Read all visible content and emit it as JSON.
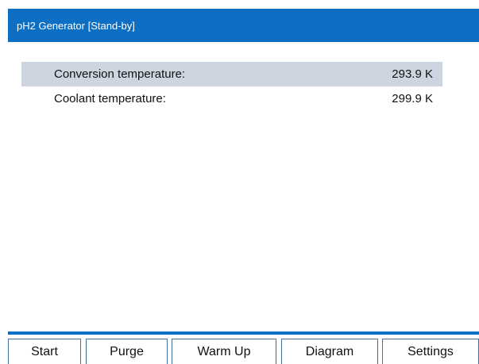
{
  "title_bar": {
    "title": "pH2 Generator  [Stand-by]"
  },
  "readings": [
    {
      "label": "Conversion temperature:",
      "value": "293.9 K"
    },
    {
      "label": "Coolant temperature:",
      "value": "299.9 K"
    }
  ],
  "colors": {
    "accent": "#0c6fc4",
    "highlight_row": "#cdd6e0"
  },
  "toolbar": {
    "start_label": "Start",
    "purge_label": "Purge",
    "warmup_label": "Warm Up",
    "diagram_label": "Diagram",
    "settings_label": "Settings"
  }
}
